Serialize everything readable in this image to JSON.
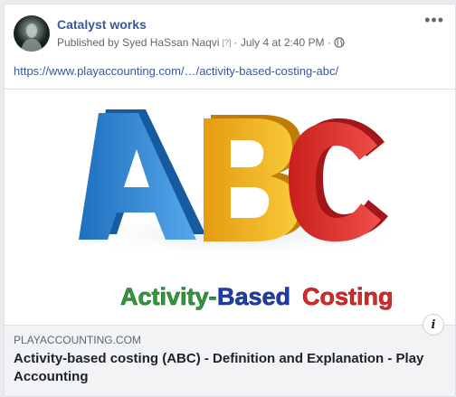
{
  "post": {
    "page_name": "Catalyst works",
    "published_by_prefix": "Published by",
    "author": "Syed HaSsan Naqvi",
    "help_mark": "[?]",
    "separator": "·",
    "timestamp": "July 4 at 2:40 PM",
    "audience_icon": "globe-icon",
    "more_icon": "more-options-icon",
    "more_label": "•••",
    "link_url": "https://www.playaccounting.com/…/activity-based-costing-abc/"
  },
  "link_preview": {
    "image": {
      "letters": [
        "A",
        "B",
        "C"
      ],
      "letter_colors": [
        "#2e88d6",
        "#f2b51c",
        "#e0322e"
      ],
      "words": [
        "Activity-",
        "Based",
        "Costing"
      ],
      "word_colors": [
        "#2f9a3a",
        "#1d3fa8",
        "#d92a2a"
      ]
    },
    "domain": "PLAYACCOUNTING.COM",
    "title": "Activity-based costing (ABC) - Definition and Explanation - Play Accounting",
    "info_label": "i",
    "info_icon": "info-icon"
  }
}
